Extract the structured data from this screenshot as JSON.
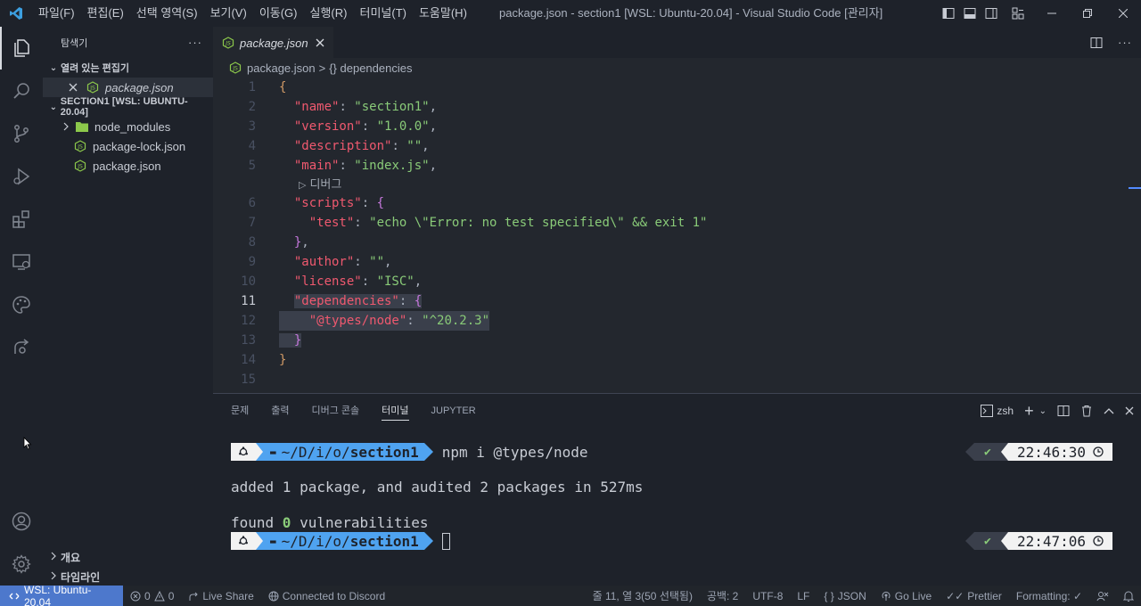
{
  "titlebar": {
    "menus": [
      "파일(F)",
      "편집(E)",
      "선택 영역(S)",
      "보기(V)",
      "이동(G)",
      "실행(R)",
      "터미널(T)",
      "도움말(H)"
    ],
    "title": "package.json - section1 [WSL: Ubuntu-20.04] - Visual Studio Code [관리자]"
  },
  "sidebar": {
    "title": "탐색기",
    "more": "···",
    "open_editors": {
      "label": "열려 있는 편집기",
      "items": [
        {
          "name": "package.json"
        }
      ]
    },
    "workspace": {
      "label": "SECTION1 [WSL: UBUNTU-20.04]",
      "items": [
        {
          "name": "node_modules",
          "type": "folder"
        },
        {
          "name": "package-lock.json",
          "type": "file"
        },
        {
          "name": "package.json",
          "type": "file"
        }
      ]
    },
    "outline_label": "개요",
    "timeline_label": "타임라인"
  },
  "editor": {
    "tab_label": "package.json",
    "breadcrumb": {
      "file": "package.json",
      "sep": ">",
      "symbol": "{} dependencies"
    },
    "codelens": "디버그",
    "current_line": 11,
    "lines": [
      {
        "n": "1",
        "t": "{"
      },
      {
        "n": "2",
        "k": "\"name\"",
        "v": "\"section1\""
      },
      {
        "n": "3",
        "k": "\"version\"",
        "v": "\"1.0.0\""
      },
      {
        "n": "4",
        "k": "\"description\"",
        "v": "\"\""
      },
      {
        "n": "5",
        "k": "\"main\"",
        "v": "\"index.js\""
      },
      {
        "n": "6",
        "k": "\"scripts\""
      },
      {
        "n": "7",
        "k": "\"test\"",
        "v": "\"echo \\\"Error: no test specified\\\" && exit 1\""
      },
      {
        "n": "8"
      },
      {
        "n": "9",
        "k": "\"author\"",
        "v": "\"\""
      },
      {
        "n": "10",
        "k": "\"license\"",
        "v": "\"ISC\""
      },
      {
        "n": "11",
        "k": "\"dependencies\""
      },
      {
        "n": "12",
        "k": "\"@types/node\"",
        "v": "\"^20.2.3\""
      },
      {
        "n": "13"
      },
      {
        "n": "14"
      },
      {
        "n": "15"
      }
    ]
  },
  "panel": {
    "tabs": [
      "문제",
      "출력",
      "디버그 콘솔",
      "터미널",
      "JUPYTER"
    ],
    "active_tab": "터미널",
    "shell": "zsh",
    "terminal": {
      "path": "~/D/i/o/",
      "dir": "section1",
      "command1": "npm i @types/node",
      "time1": "22:46:30",
      "output1": "added 1 package, and audited 2 packages in 527ms",
      "output2_pre": "found ",
      "output2_num": "0",
      "output2_post": " vulnerabilities",
      "time2": "22:47:06",
      "check": "✔"
    }
  },
  "statusbar": {
    "remote": "WSL: Ubuntu-20.04",
    "errors": "0",
    "warnings": "0",
    "live_share": "Live Share",
    "discord": "Connected to Discord",
    "position": "줄 11, 열 3(50 선택됨)",
    "spaces": "공백: 2",
    "encoding": "UTF-8",
    "eol": "LF",
    "language": "JSON",
    "go_live": "Go Live",
    "prettier": "Prettier",
    "formatting": "Formatting: ✓"
  },
  "colors": {
    "accent": "#4d78cc",
    "string": "#89ca78",
    "key": "#ef596f",
    "bracket": "#d19a66",
    "prompt_path": "#4fa3f0"
  }
}
